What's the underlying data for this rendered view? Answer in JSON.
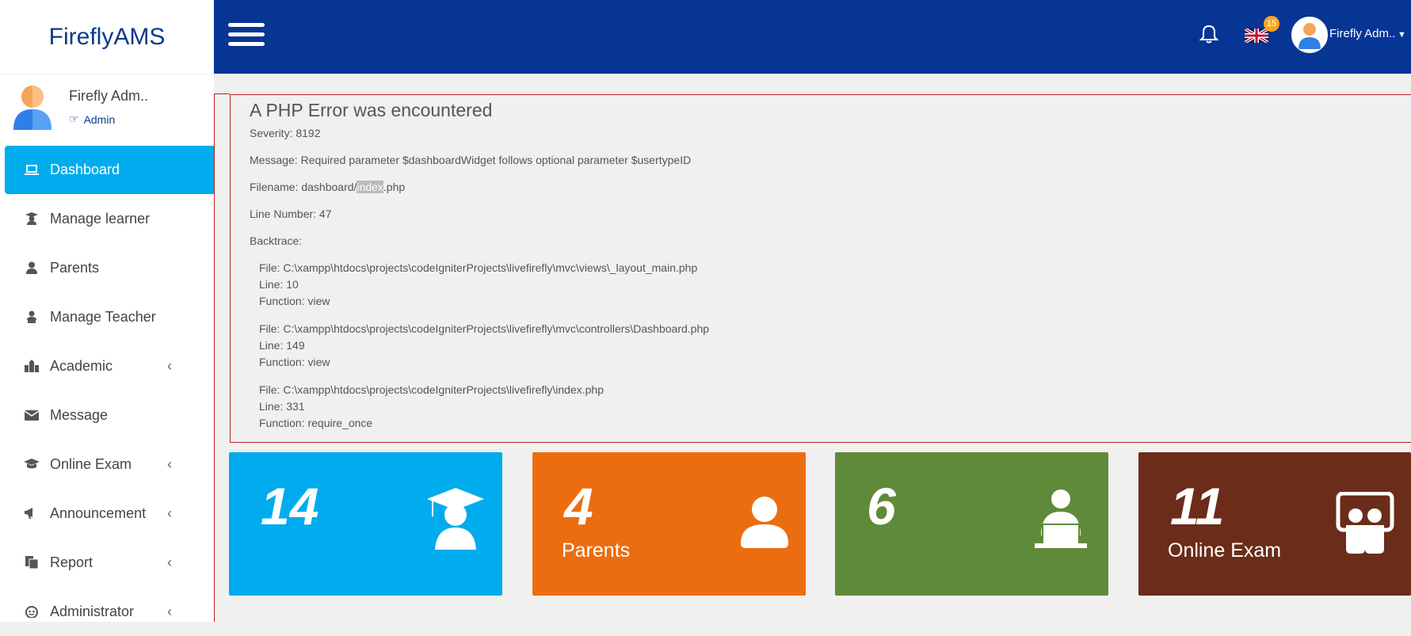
{
  "app": {
    "brand": "FireflyAMS"
  },
  "profile": {
    "name": "Firefly Adm..",
    "role": "Admin"
  },
  "header": {
    "notification_count": "15",
    "user_name": "Firefly Adm.."
  },
  "sidebar": {
    "items": [
      {
        "label": "Dashboard",
        "icon": "laptop-icon",
        "active": true,
        "chevron": false
      },
      {
        "label": "Manage learner",
        "icon": "student-icon",
        "chevron": false
      },
      {
        "label": "Parents",
        "icon": "user-icon",
        "chevron": false
      },
      {
        "label": "Manage Teacher",
        "icon": "teacher-icon",
        "chevron": false
      },
      {
        "label": "Academic",
        "icon": "school-icon",
        "chevron": true
      },
      {
        "label": "Message",
        "icon": "envelope-icon",
        "chevron": false
      },
      {
        "label": "Online Exam",
        "icon": "graduation-cap-icon",
        "chevron": true
      },
      {
        "label": "Announcement",
        "icon": "megaphone-icon",
        "chevron": true
      },
      {
        "label": "Report",
        "icon": "report-icon",
        "chevron": true
      },
      {
        "label": "Administrator",
        "icon": "admin-icon",
        "chevron": true
      }
    ]
  },
  "error": {
    "title": "A PHP Error was encountered",
    "severity": "Severity: 8192",
    "message": "Message: Required parameter $dashboardWidget follows optional parameter $usertypeID",
    "filename_prefix": "Filename: dashboard/",
    "filename_highlight": "index",
    "filename_suffix": ".php",
    "line_number": "Line Number: 47",
    "backtrace_label": "Backtrace:",
    "trace": [
      {
        "file": "File: C:\\xampp\\htdocs\\projects\\codeIgniterProjects\\livefirefly\\mvc\\views\\_layout_main.php",
        "line": "Line: 10",
        "function": "Function: view"
      },
      {
        "file": "File: C:\\xampp\\htdocs\\projects\\codeIgniterProjects\\livefirefly\\mvc\\controllers\\Dashboard.php",
        "line": "Line: 149",
        "function": "Function: view"
      },
      {
        "file": "File: C:\\xampp\\htdocs\\projects\\codeIgniterProjects\\livefirefly\\index.php",
        "line": "Line: 331",
        "function": "Function: require_once"
      }
    ]
  },
  "cards": [
    {
      "value": "14",
      "label": "",
      "color": "#00aced",
      "icon": "graduate-icon"
    },
    {
      "value": "4",
      "label": "Parents",
      "color": "#ec6d10",
      "icon": "user-icon"
    },
    {
      "value": "6",
      "label": "",
      "color": "#5f8a39",
      "icon": "teacher-laptop-icon"
    },
    {
      "value": "11",
      "label": "Online Exam",
      "color": "#6b2c1a",
      "icon": "exam-icon"
    }
  ]
}
